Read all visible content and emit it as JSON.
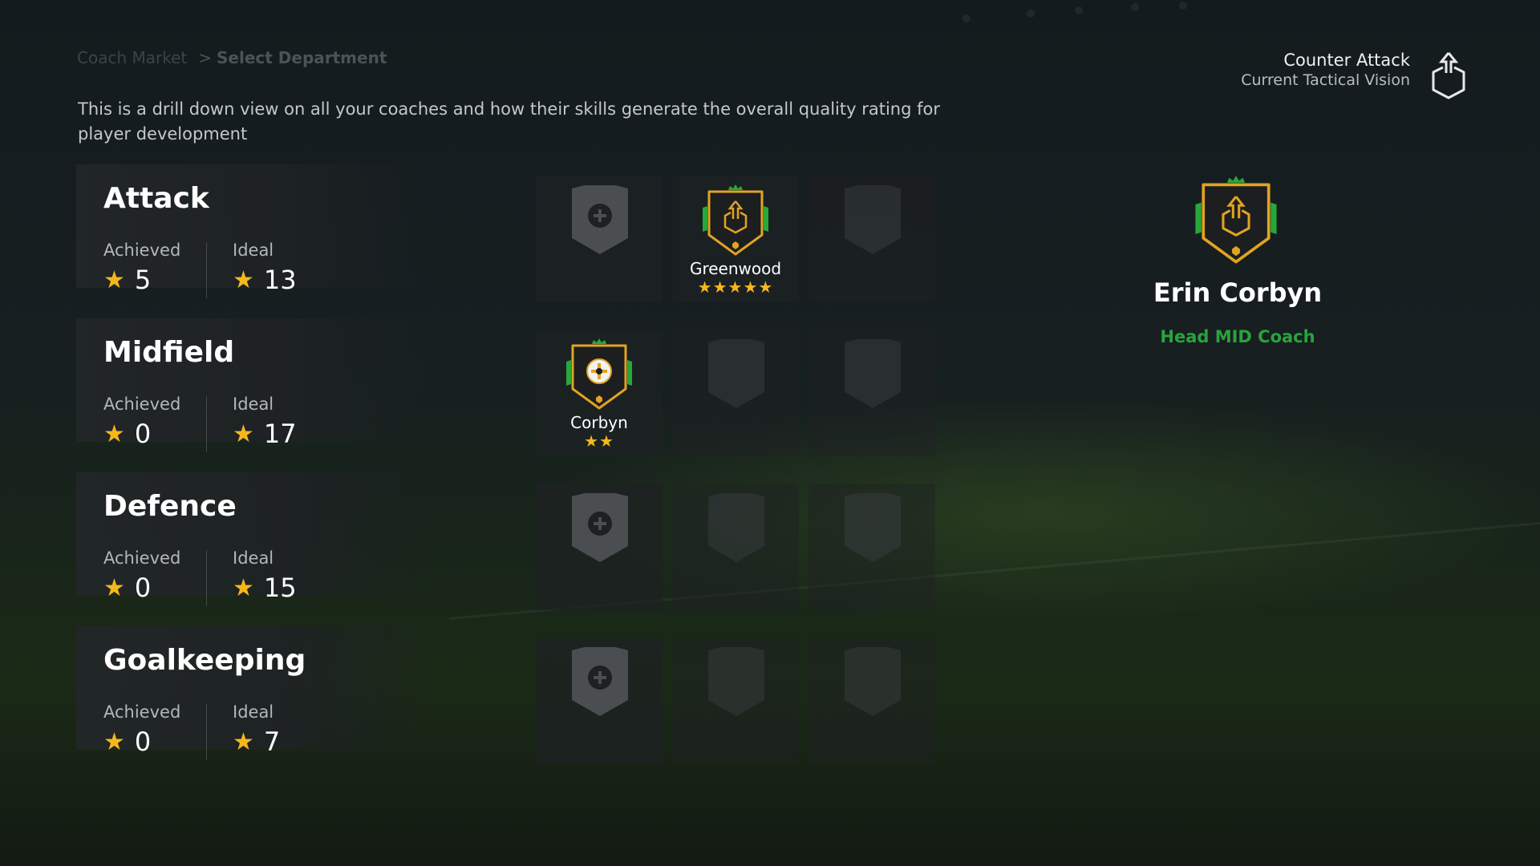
{
  "breadcrumb": {
    "root": "Coach Market",
    "separator": ">",
    "current": "Select Department"
  },
  "description": "This is a drill down view on all your coaches and how their skills generate the overall quality rating for player development",
  "tactic": {
    "name": "Counter Attack",
    "label": "Current Tactical Vision",
    "icon": "tactic-arrow-icon"
  },
  "labels": {
    "achieved": "Achieved",
    "ideal": "Ideal",
    "star": "★"
  },
  "departments": [
    {
      "name": "Attack",
      "achieved": "5",
      "ideal": "13",
      "slots": [
        {
          "state": "add",
          "icon": "plus-icon"
        },
        {
          "state": "coach",
          "name": "Greenwood",
          "stars": "★★★★★",
          "rating": 5
        },
        {
          "state": "empty"
        }
      ]
    },
    {
      "name": "Midfield",
      "achieved": "0",
      "ideal": "17",
      "slots": [
        {
          "state": "coach",
          "name": "Corbyn",
          "stars": "★★",
          "rating": 2,
          "selected": true
        },
        {
          "state": "empty"
        },
        {
          "state": "empty"
        }
      ]
    },
    {
      "name": "Defence",
      "achieved": "0",
      "ideal": "15",
      "slots": [
        {
          "state": "add",
          "icon": "plus-icon"
        },
        {
          "state": "empty"
        },
        {
          "state": "empty"
        }
      ]
    },
    {
      "name": "Goalkeeping",
      "achieved": "0",
      "ideal": "7",
      "slots": [
        {
          "state": "add",
          "icon": "plus-icon"
        },
        {
          "state": "empty"
        },
        {
          "state": "empty"
        }
      ]
    }
  ],
  "selected_coach": {
    "name": "Erin Corbyn",
    "role": "Head MID Coach"
  },
  "colors": {
    "star": "#f5b81c",
    "accent_green": "#2aa33c",
    "badge_gold": "#e0a322",
    "badge_dark": "#1c1e20",
    "slot_shield": "#4a4e51"
  }
}
